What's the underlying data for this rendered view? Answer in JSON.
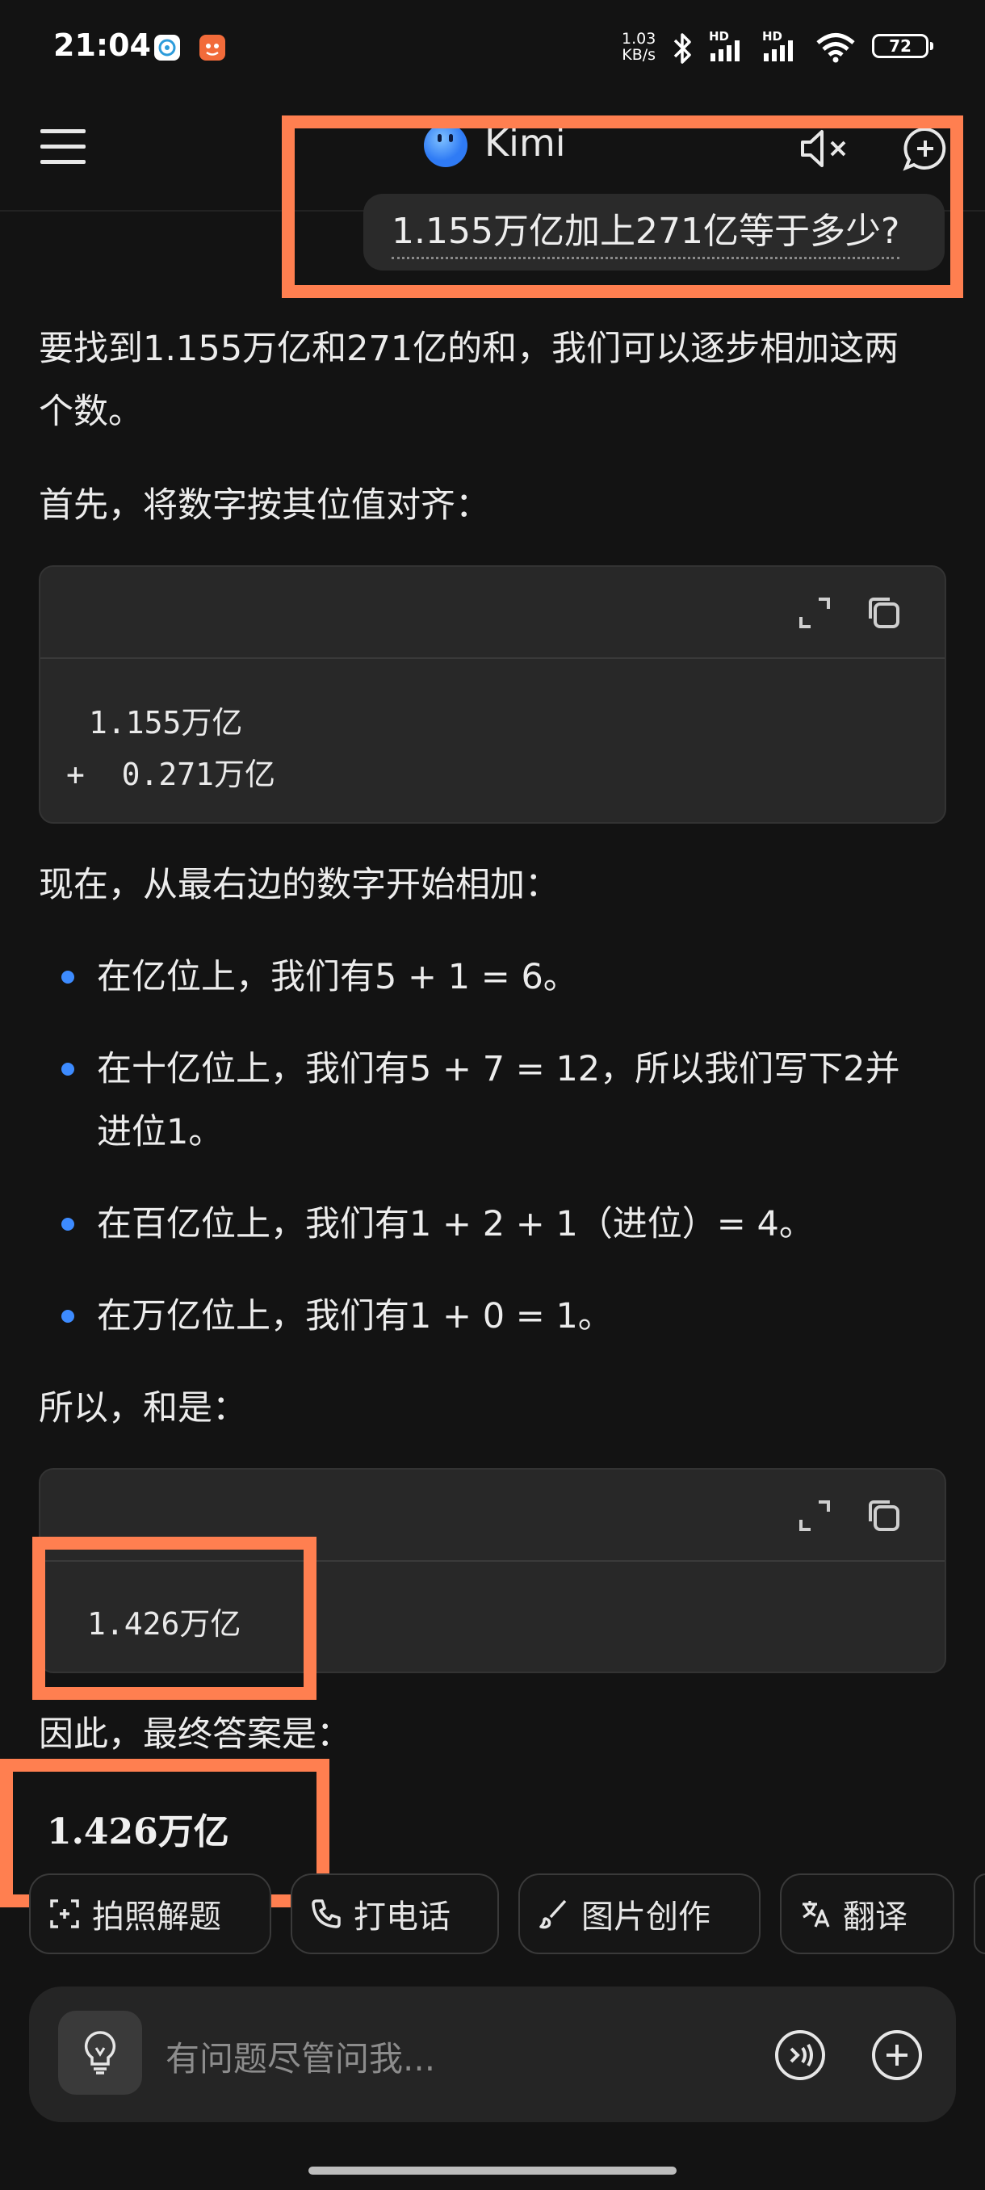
{
  "status_bar": {
    "time": "21:04",
    "net_speed_value": "1.03",
    "net_speed_unit": "KB/s",
    "hd1": "HD",
    "hd2": "HD",
    "battery": "72"
  },
  "header": {
    "app_title": "Kimi",
    "question": "1.155万亿加上271亿等于多少?"
  },
  "answer": {
    "intro": "要找到1.155万亿和271亿的和，我们可以逐步相加这两个数。",
    "intro_line1": "要找到1.155万亿和271亿的和，我们可以逐步相加这两",
    "intro_line2": "个数。",
    "align_text": "首先，将数字按其位值对齐：",
    "code1": {
      "line1": "1.155万亿",
      "line2": "+  0.271万亿"
    },
    "add_intro": "现在，从最右边的数字开始相加：",
    "bullets": [
      "在亿位上，我们有5 + 1 = 6。",
      "在十亿位上，我们有5 + 7 = 12，所以我们写下2并",
      "进位1。",
      "在百亿位上，我们有1 + 2 + 1（进位）= 4。",
      "在万亿位上，我们有1 + 0 = 1。"
    ],
    "sum_label": "所以，和是：",
    "code2": {
      "line1": "1.426万亿"
    },
    "final_label": "因此，最终答案是：",
    "final_answer": "1.426万亿"
  },
  "chips": [
    {
      "label": "拍照解题",
      "icon": "camera-solve-icon"
    },
    {
      "label": "打电话",
      "icon": "phone-icon"
    },
    {
      "label": "图片创作",
      "icon": "brush-icon"
    },
    {
      "label": "翻译",
      "icon": "translate-icon"
    }
  ],
  "input": {
    "placeholder": "有问题尽管问我..."
  },
  "colors": {
    "background": "#131313",
    "highlight": "#FF7F50",
    "bullet": "#3D8BFF",
    "code_bg": "#282828"
  }
}
